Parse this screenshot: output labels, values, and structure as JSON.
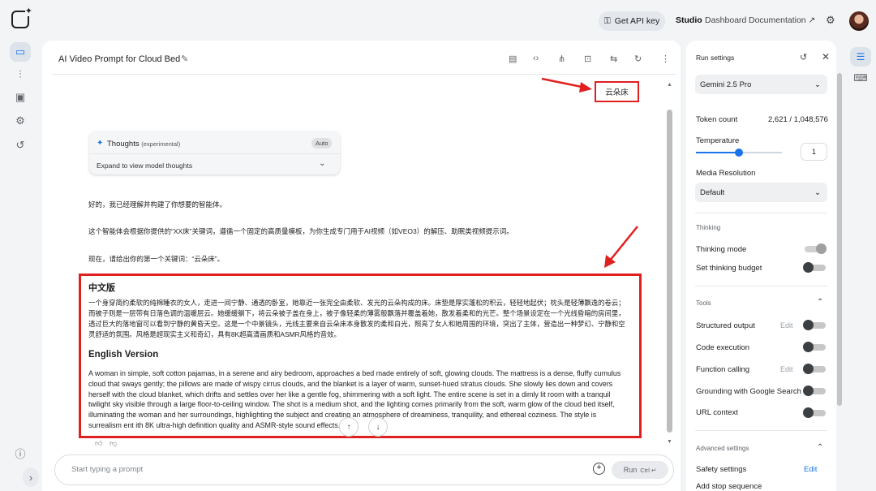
{
  "header": {
    "api_key": "Get API key",
    "nav": [
      "Studio",
      "Dashboard",
      "Documentation"
    ]
  },
  "chat": {
    "title": "AI Video Prompt for Cloud Bed",
    "keyword_tag": "云朵床",
    "thoughts": {
      "label": "Thoughts",
      "tag": "(experimental)",
      "badge": "Auto",
      "expand": "Expand to view model thoughts"
    },
    "intro": [
      "好的，我已经理解并构建了你想要的智能体。",
      "这个智能体会根据你提供的“XX床”关键词，遵循一个固定的高质量模板，为你生成专门用于AI视频（如VEO3）的解压、助眠类视频提示词。",
      "现在，请给出你的第一个关键词：“云朵床”。"
    ],
    "cn_heading": "中文版",
    "cn_body": "一个身穿简约柔软的纯棉睡衣的女人，走进一间宁静、通透的卧室，她靠近一张完全由柔软、发光的云朵构成的床。床垫是厚实蓬松的积云，轻轻地起伏；枕头是轻薄飘逸的卷云；而被子则是一层带有日落色调的温暖层云。她缓缓躺下，将云朵被子盖在身上，被子像轻柔的薄雾般飘落并覆盖着她，散发着柔和的光芒。整个场景设定在一个光线昏暗的房间里，透过巨大的落地窗可以看到宁静的黄昏天空。这是一个中景镜头，光线主要来自云朵床本身散发的柔和白光，照亮了女人和她周围的环境，突出了主体，营造出一种梦幻、宁静和空灵舒适的氛围。风格是超现实主义和奇幻，具有8K超高清画质和ASMR风格的音效。",
    "en_heading": "English Version",
    "en_body": "A woman in simple, soft cotton pajamas, in a serene and airy bedroom, approaches a bed made entirely of soft, glowing clouds. The mattress is a dense, fluffy cumulus cloud that sways gently; the pillows are made of wispy cirrus clouds, and the blanket is a layer of warm, sunset-hued stratus clouds. She slowly lies down and covers herself with the cloud blanket, which drifts and settles over her like a gentle fog, shimmering with a soft light. The entire scene is set in a dimly lit room with a tranquil twilight sky visible through a large floor-to-ceiling window. The shot is a medium shot, and the lighting comes primarily from the soft, warm glow of the cloud bed itself, illuminating the woman and her surroundings, highlighting the subject and creating an atmosphere of dreaminess, tranquility, and ethereal coziness. The style is surrealism   ent    ith 8K ultra-high definition quality and ASMR-style sound effects.",
    "prompt_placeholder": "Start typing a prompt",
    "run_label": "Run",
    "run_shortcut": "Ctrl ↵"
  },
  "settings": {
    "title": "Run settings",
    "model": "Gemini 2.5 Pro",
    "token_label": "Token count",
    "token_value": "2,621 / 1,048,576",
    "temperature_label": "Temperature",
    "temperature_value": "1",
    "temperature_level": 0.5,
    "media_label": "Media Resolution",
    "media_value": "Default",
    "thinking_heading": "Thinking",
    "thinking_mode": "Thinking mode",
    "thinking_budget": "Set thinking budget",
    "tools_heading": "Tools",
    "structured": "Structured output",
    "code_exec": "Code execution",
    "function_call": "Function calling",
    "grounding": "Grounding with Google Search",
    "url_context": "URL context",
    "edit": "Edit",
    "advanced_heading": "Advanced settings",
    "safety": "Safety settings",
    "safety_edit": "Edit",
    "stop_seq": "Add stop sequence"
  },
  "colors": {
    "accent": "#1a73e8",
    "highlight": "#e02020"
  }
}
